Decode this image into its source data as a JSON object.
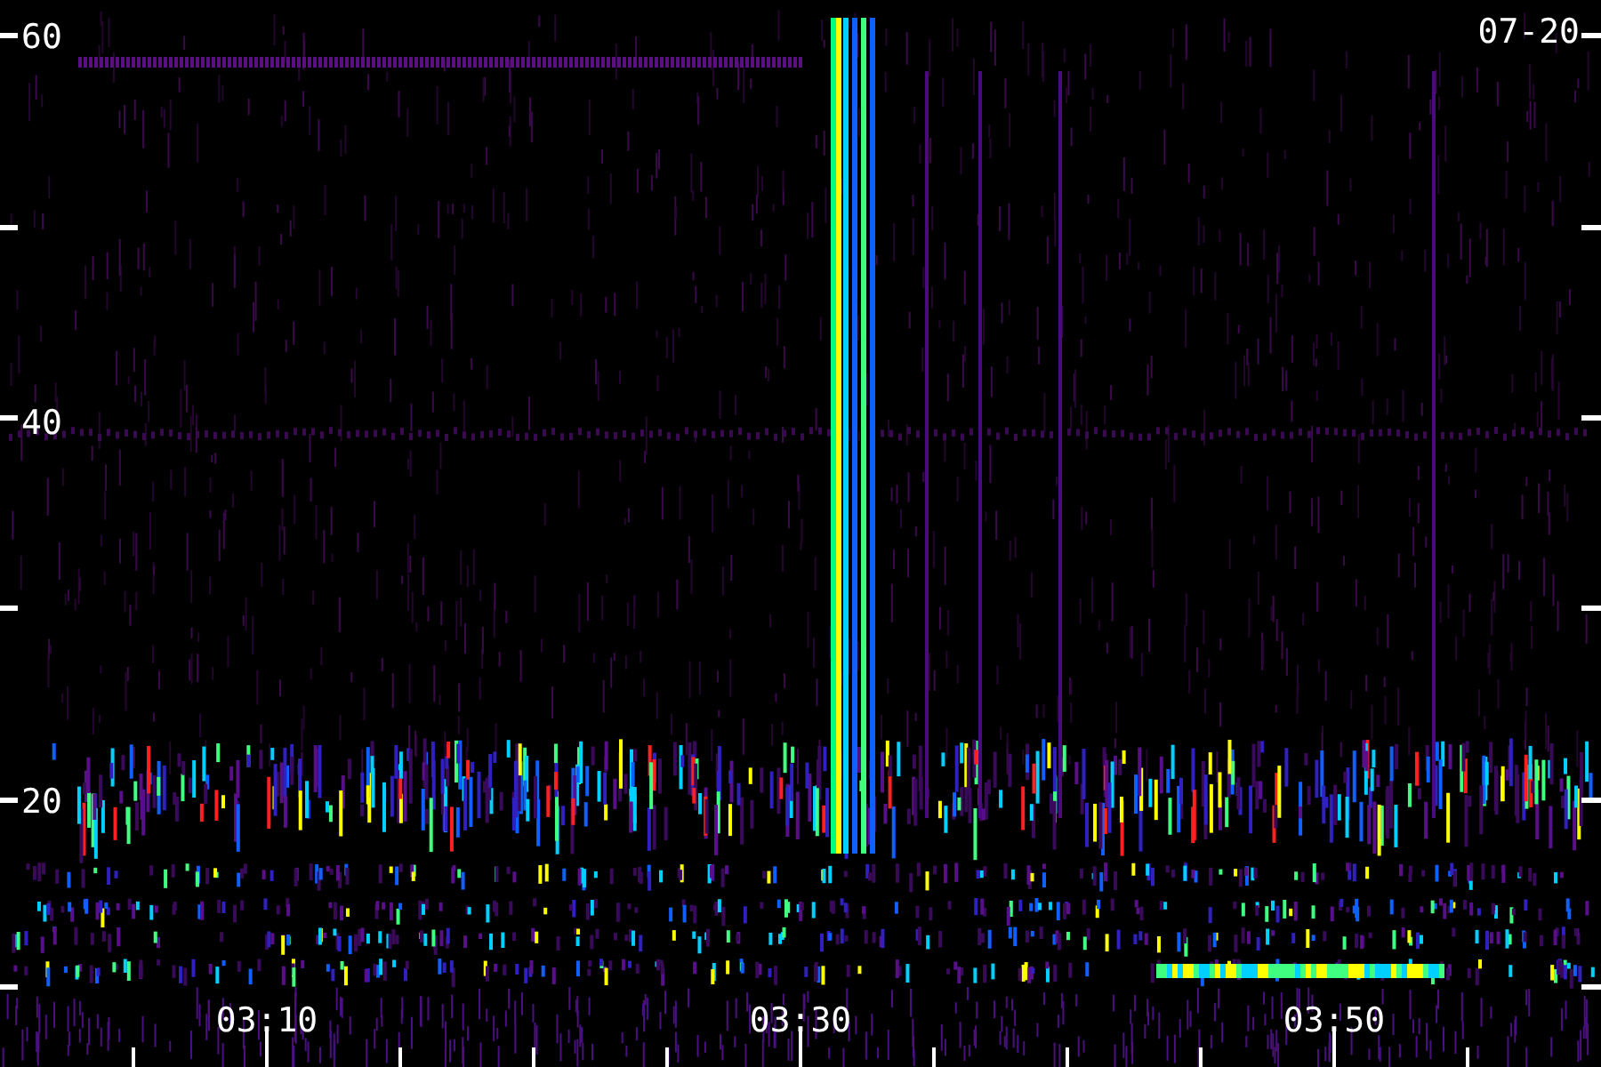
{
  "date": "07-20",
  "y_axis": {
    "labels": [
      "60",
      "40",
      "20"
    ]
  },
  "x_axis": {
    "labels": [
      "03:10",
      "03:30",
      "03:50"
    ]
  }
}
